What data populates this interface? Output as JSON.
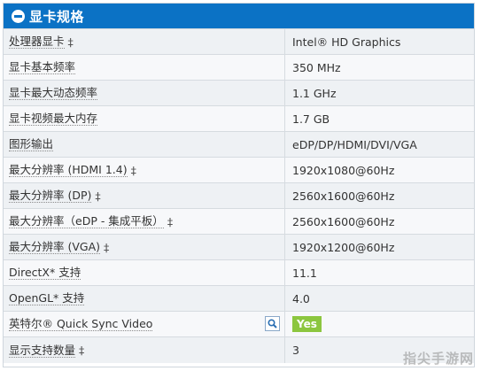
{
  "header": {
    "title": "显卡规格"
  },
  "rows": [
    {
      "label": "处理器显卡",
      "dagger": "‡",
      "value": "Intel® HD Graphics"
    },
    {
      "label": "显卡基本频率",
      "dagger": "",
      "value": "350 MHz"
    },
    {
      "label": "显卡最大动态频率",
      "dagger": "",
      "value": "1.1 GHz"
    },
    {
      "label": "显卡视频最大内存",
      "dagger": "",
      "value": "1.7 GB"
    },
    {
      "label": "图形输出",
      "dagger": "",
      "value": "eDP/DP/HDMI/DVI/VGA"
    },
    {
      "label": "最大分辨率 (HDMI 1.4)",
      "dagger": "‡",
      "value": "1920x1080@60Hz"
    },
    {
      "label": "最大分辨率 (DP)",
      "dagger": "‡",
      "value": "2560x1600@60Hz"
    },
    {
      "label": "最大分辨率（eDP - 集成平板）",
      "dagger": "‡",
      "value": "2560x1600@60Hz"
    },
    {
      "label": "最大分辨率 (VGA)",
      "dagger": "‡",
      "value": "1920x1200@60Hz"
    },
    {
      "label": "DirectX* 支持",
      "dagger": "",
      "value": "11.1"
    },
    {
      "label": "OpenGL* 支持",
      "dagger": "",
      "value": "4.0"
    },
    {
      "label": "英特尔® Quick Sync Video",
      "dagger": "",
      "value": "Yes"
    },
    {
      "label": "显示支持数量",
      "dagger": "‡",
      "value": "3"
    }
  ],
  "watermark": "指尖手游网",
  "colors": {
    "header_bg": "#0b72c5",
    "yes_badge": "#8cc63f",
    "row_odd": "#eef1f4",
    "row_even": "#f7f8fa"
  },
  "icons": {
    "header": "minus-circle-icon",
    "quick_sync": "search-icon"
  }
}
